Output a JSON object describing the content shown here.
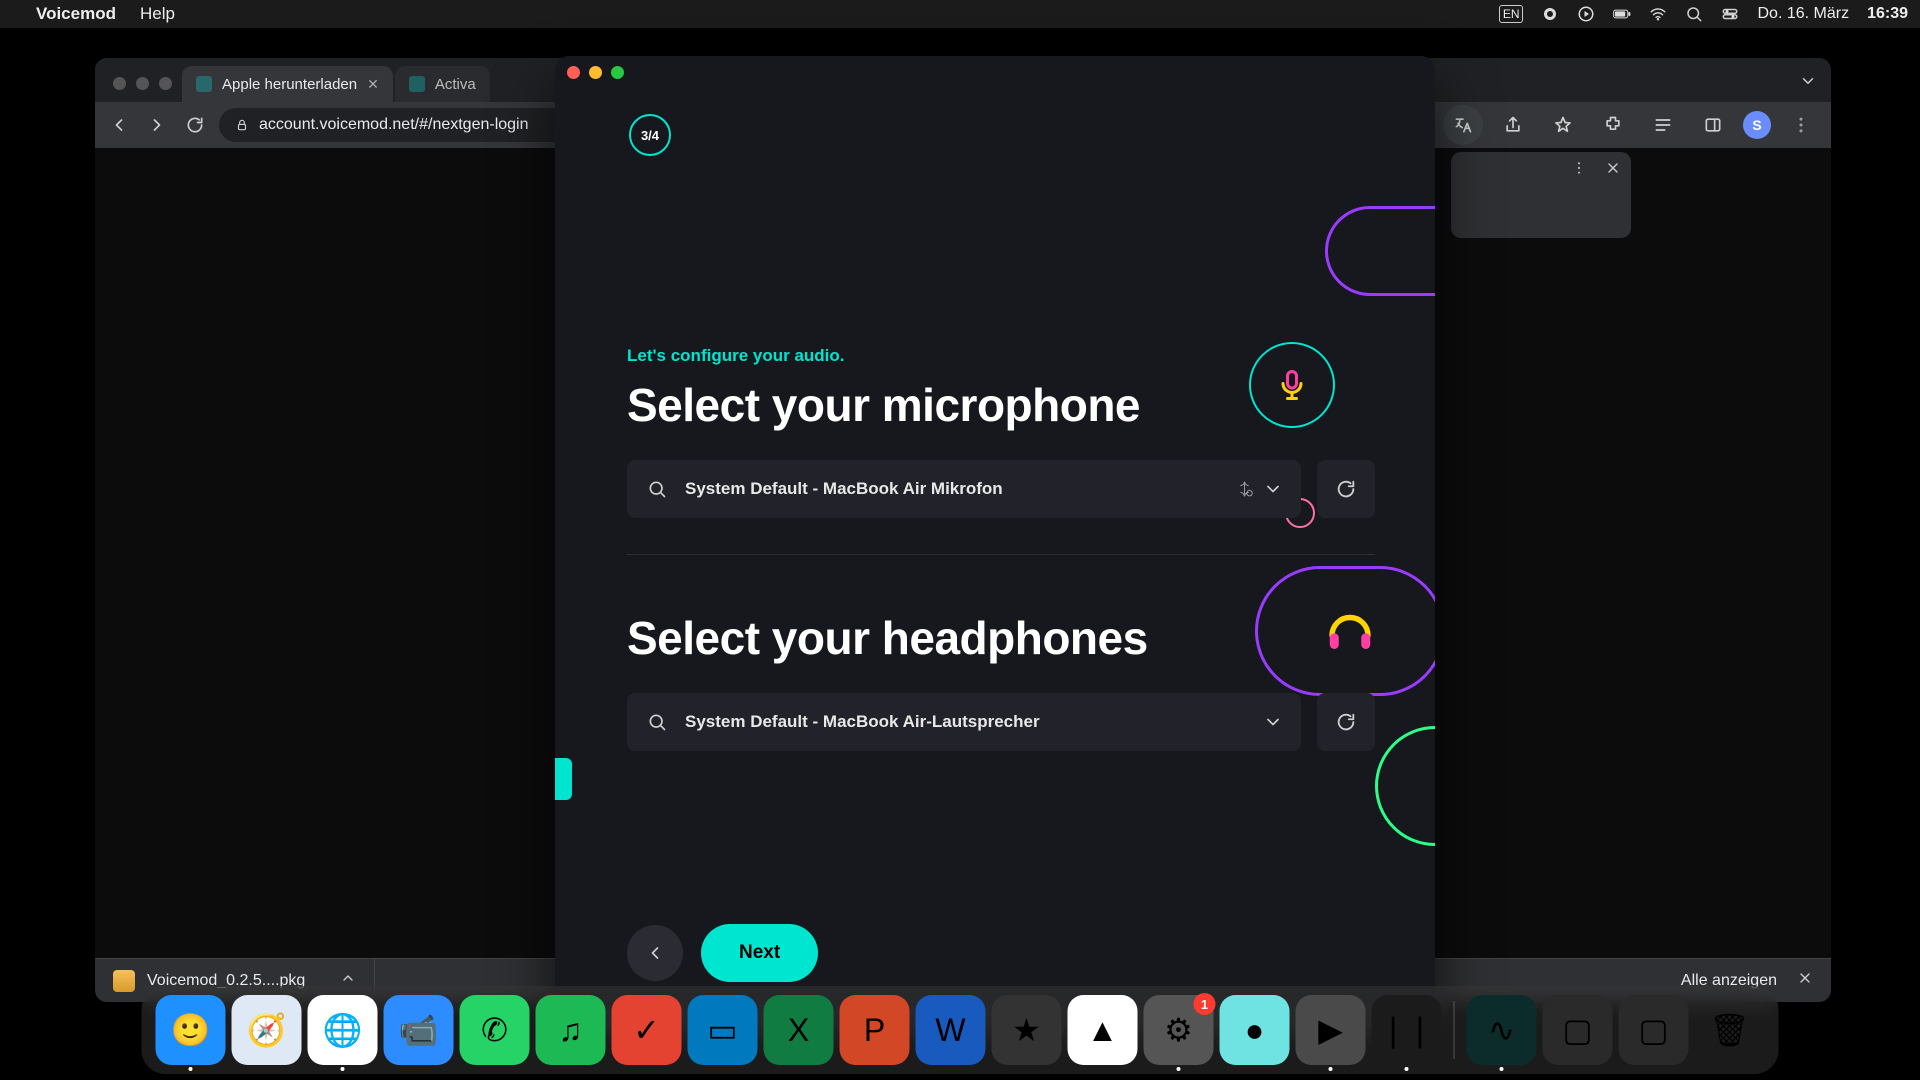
{
  "menubar": {
    "app_name": "Voicemod",
    "menus": [
      "Help"
    ],
    "date": "Do. 16. März",
    "time": "16:39"
  },
  "chrome": {
    "tabs": [
      {
        "title": "Apple herunterladen",
        "active": true
      },
      {
        "title": "Activa",
        "active": false
      }
    ],
    "url": "account.voicemod.net/#/nextgen-login",
    "avatar_initial": "S",
    "download": {
      "filename": "Voicemod_0.2.5....pkg"
    },
    "show_all_label": "Alle anzeigen"
  },
  "voicemod": {
    "step_label": "3/4",
    "eyebrow": "Let's configure your audio.",
    "mic_heading": "Select your microphone",
    "mic_value": "System Default - MacBook Air Mikrofon",
    "hp_heading": "Select your headphones",
    "hp_value": "System Default - MacBook Air-Lautsprecher",
    "next_label": "Next"
  },
  "dock": {
    "apps": [
      {
        "name": "finder",
        "color": "#1e90ff",
        "glyph": "🙂",
        "running": true
      },
      {
        "name": "safari",
        "color": "#dfe9f5",
        "glyph": "🧭",
        "running": false
      },
      {
        "name": "chrome",
        "color": "#fff",
        "glyph": "🌐",
        "running": true
      },
      {
        "name": "zoom",
        "color": "#2d8cff",
        "glyph": "📹",
        "running": false
      },
      {
        "name": "whatsapp",
        "color": "#25d366",
        "glyph": "✆",
        "running": false
      },
      {
        "name": "spotify",
        "color": "#1db954",
        "glyph": "♫",
        "running": false
      },
      {
        "name": "todoist",
        "color": "#e44332",
        "glyph": "✓",
        "running": false
      },
      {
        "name": "trello",
        "color": "#0079bf",
        "glyph": "▭",
        "running": false
      },
      {
        "name": "excel",
        "color": "#107c41",
        "glyph": "X",
        "running": false
      },
      {
        "name": "powerpoint",
        "color": "#d24726",
        "glyph": "P",
        "running": false
      },
      {
        "name": "word",
        "color": "#185abd",
        "glyph": "W",
        "running": false
      },
      {
        "name": "imovie",
        "color": "#333",
        "glyph": "★",
        "running": false
      },
      {
        "name": "drive",
        "color": "#fff",
        "glyph": "▲",
        "running": false
      },
      {
        "name": "settings",
        "color": "#555",
        "glyph": "⚙",
        "running": true,
        "badge": "1"
      },
      {
        "name": "siri",
        "color": "#6fe3e1",
        "glyph": "●",
        "running": false
      },
      {
        "name": "quicktime",
        "color": "#4a4a4a",
        "glyph": "▶",
        "running": true
      },
      {
        "name": "voice-memos",
        "color": "#1b1b1b",
        "glyph": "❘❘",
        "running": true
      }
    ],
    "right_apps": [
      {
        "name": "voicemod",
        "color": "#0b2c2a",
        "glyph": "∿",
        "running": true
      },
      {
        "name": "screenshot-a",
        "color": "#2a2a2a",
        "glyph": "▢",
        "running": false
      },
      {
        "name": "screenshot-b",
        "color": "#2a2a2a",
        "glyph": "▢",
        "running": false
      },
      {
        "name": "trash",
        "color": "transparent",
        "glyph": "🗑",
        "running": false
      }
    ]
  }
}
